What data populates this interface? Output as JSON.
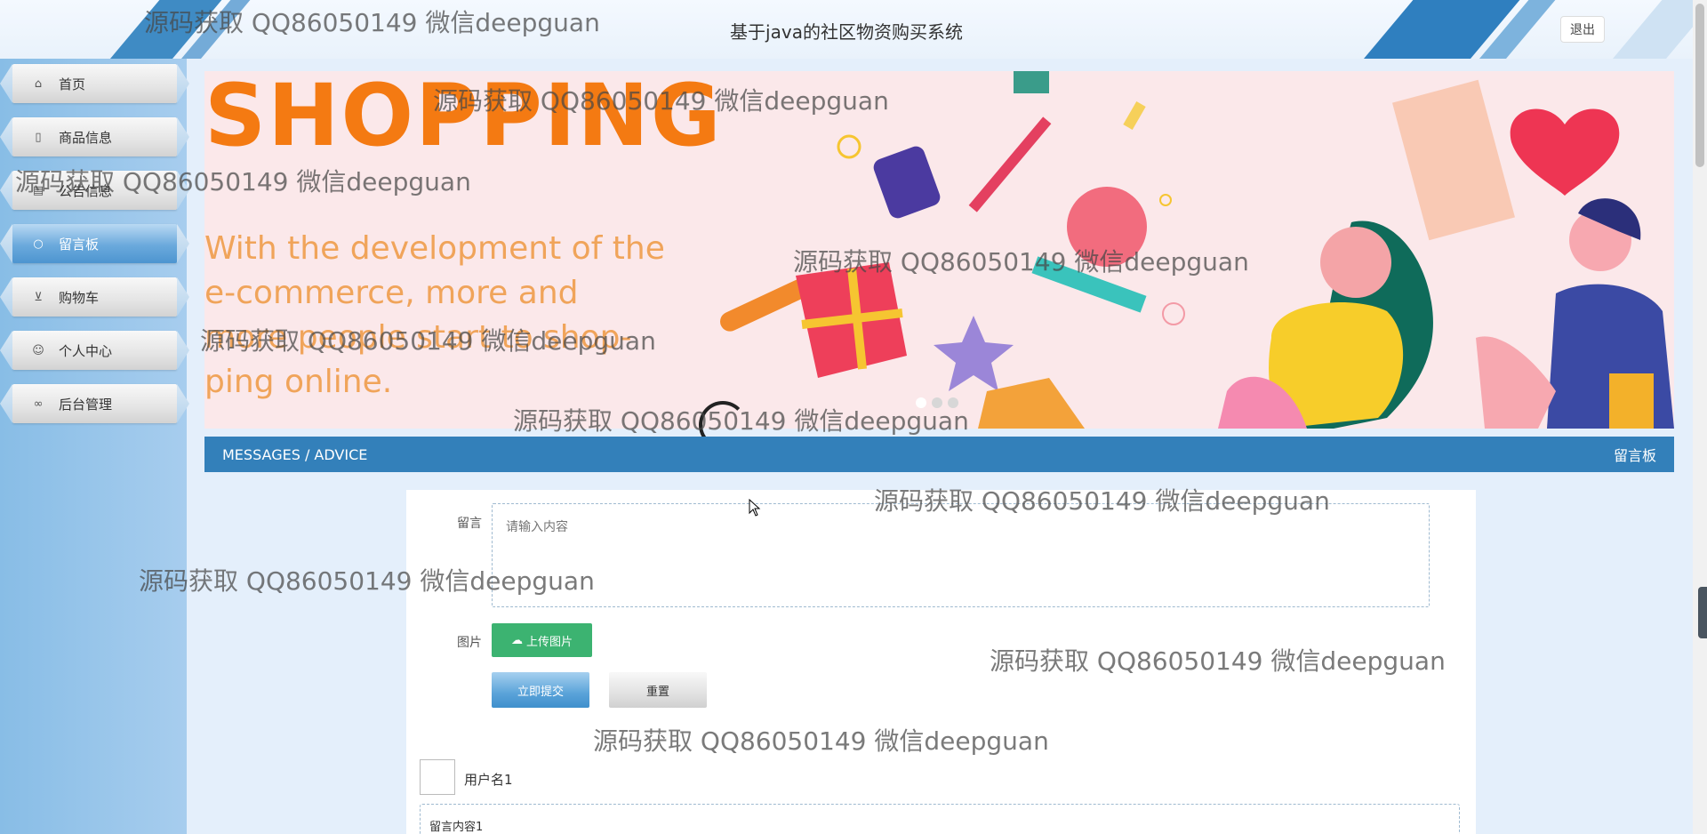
{
  "header": {
    "title": "基于java的社区物资购买系统",
    "logout_label": "退出"
  },
  "sidebar": {
    "items": [
      {
        "label": "首页",
        "icon": "home-icon"
      },
      {
        "label": "商品信息",
        "icon": "file-icon"
      },
      {
        "label": "公告信息",
        "icon": "notice-icon"
      },
      {
        "label": "留言板",
        "icon": "message-icon",
        "active": true
      },
      {
        "label": "购物车",
        "icon": "cart-icon"
      },
      {
        "label": "个人中心",
        "icon": "user-icon"
      },
      {
        "label": "后台管理",
        "icon": "link-icon"
      }
    ]
  },
  "banner": {
    "headline": "SHOPPING",
    "text": "With the development of the e-commerce, more and more people start to shop-ping online."
  },
  "section": {
    "title_en": "MESSAGES / ADVICE",
    "title_cn": "留言板"
  },
  "form": {
    "message_label": "留言",
    "message_placeholder": "请输入内容",
    "image_label": "图片",
    "upload_label": "上传图片",
    "submit_label": "立即提交",
    "reset_label": "重置"
  },
  "comments": [
    {
      "username": "用户名1",
      "content": "留言内容1"
    }
  ],
  "watermark": "源码获取 QQ86050149 微信deepguan",
  "colors": {
    "primary": "#3380ba",
    "sidebar": "#a7cdee",
    "upload_green": "#3cb371",
    "banner_orange": "#f47a12"
  }
}
